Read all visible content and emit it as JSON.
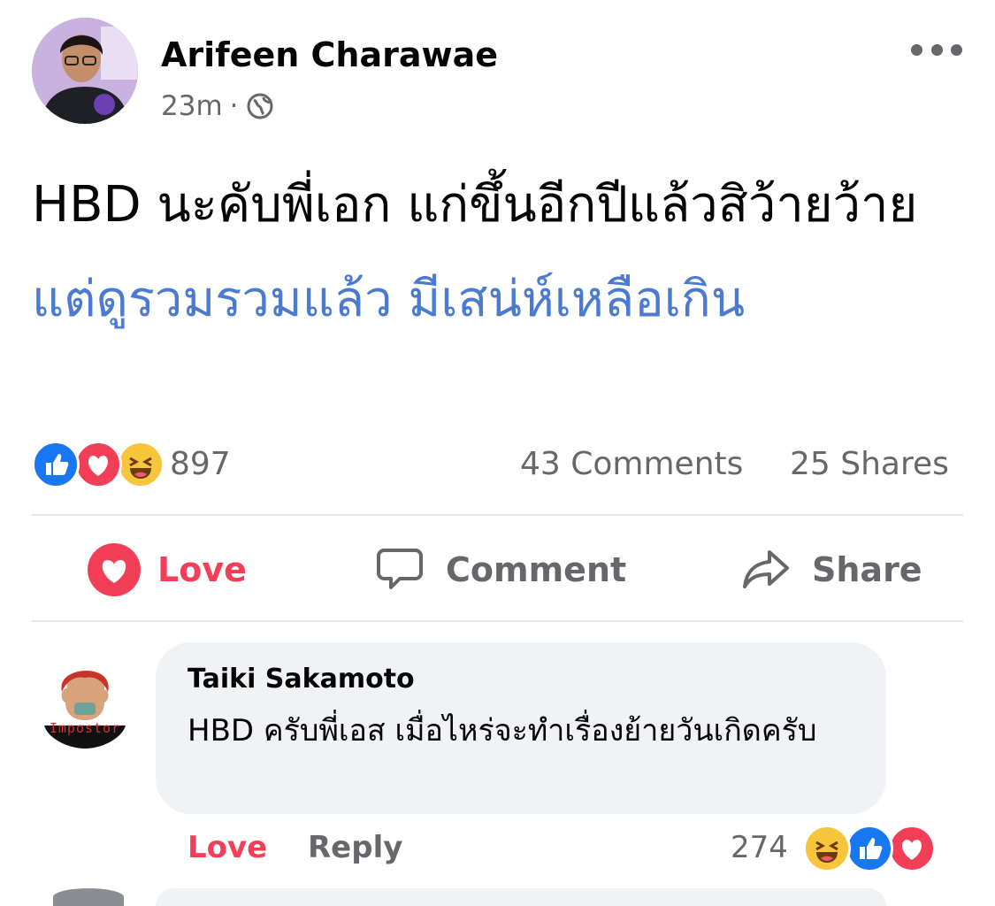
{
  "post": {
    "author": "Arifeen Charawae",
    "time": "23m",
    "separator": "·",
    "privacy_icon": "globe-icon",
    "text_plain": "HBD นะคับพี่เอก แก่ขึ้นอีกปีแล้วสิว้ายว้าย ",
    "text_link": "แต่ดูรวมรวมแล้ว มีเสน่ห์เหลือเกิน",
    "reactions": [
      "like-icon",
      "love-icon",
      "haha-icon"
    ],
    "reaction_count": "897",
    "comments_count": "43 Comments",
    "shares_count": "25 Shares"
  },
  "actions": {
    "love": "Love",
    "comment": "Comment",
    "share": "Share"
  },
  "comment": {
    "author": "Taiki Sakamoto",
    "avatar_text": "Impostor",
    "text": "HBD ครับพี่เอส เมื่อไหร่จะทำเรื่องย้ายวันเกิดครับ",
    "love_label": "Love",
    "reply_label": "Reply",
    "reaction_count": "274",
    "reactions": [
      "haha-icon",
      "like-icon",
      "love-icon"
    ]
  },
  "colors": {
    "link": "#4a7bd0",
    "love": "#f33e58",
    "like": "#1877f2",
    "muted": "#65676b",
    "bubble": "#f0f2f5"
  }
}
